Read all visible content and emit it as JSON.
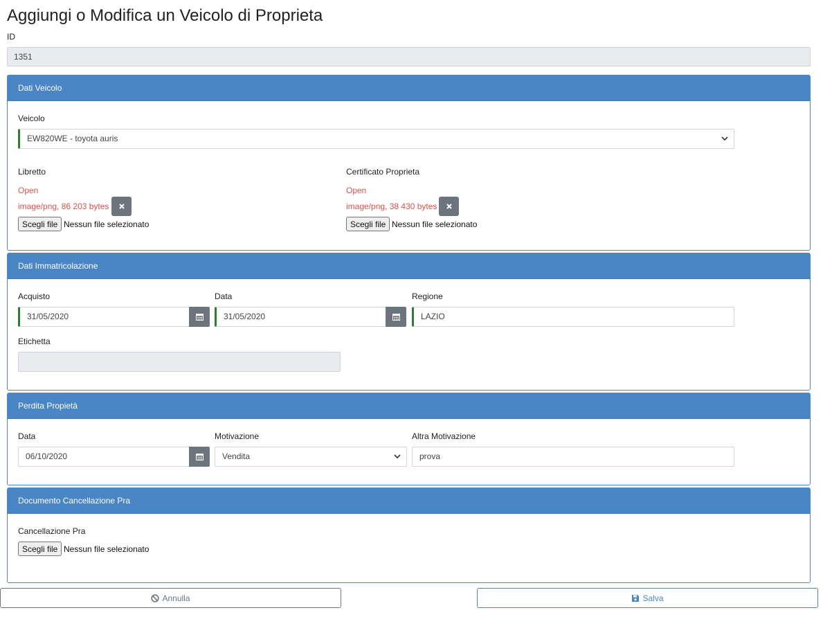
{
  "page": {
    "title": "Aggiungi o Modifica un Veicolo di Proprieta"
  },
  "id_field": {
    "label": "ID",
    "value": "1351"
  },
  "dati_veicolo": {
    "heading": "Dati Veicolo",
    "veicolo_label": "Veicolo",
    "veicolo_value": "EW820WE - toyota auris",
    "libretto": {
      "label": "Libretto",
      "link": "Open",
      "file_info": "image/png, 86 203 bytes",
      "choose_label": "Scegli file",
      "no_file": "Nessun file selezionato"
    },
    "certificato": {
      "label": "Certificato Proprieta",
      "link": "Open",
      "file_info": "image/png, 38 430 bytes",
      "choose_label": "Scegli file",
      "no_file": "Nessun file selezionato"
    }
  },
  "dati_immatricolazione": {
    "heading": "Dati Immatricolazione",
    "acquisto_label": "Acquisto",
    "acquisto_value": "31/05/2020",
    "data_label": "Data",
    "data_value": "31/05/2020",
    "regione_label": "Regione",
    "regione_value": "LAZIO",
    "etichetta_label": "Etichetta",
    "etichetta_value": ""
  },
  "perdita_proprieta": {
    "heading": "Perdita Propietà",
    "data_label": "Data",
    "data_value": "06/10/2020",
    "motivazione_label": "Motivazione",
    "motivazione_value": "Vendita",
    "altra_label": "Altra Motivazione",
    "altra_value": "prova"
  },
  "documento_cancellazione": {
    "heading": "Documento Cancellazione Pra",
    "label": "Cancellazione Pra",
    "choose_label": "Scegli file",
    "no_file": "Nessun file selezionato"
  },
  "footer": {
    "cancel_label": "Annulla",
    "save_label": "Salva"
  },
  "colors": {
    "primary": "#4a86c5",
    "danger": "#d9534f",
    "secondary": "#6c757d",
    "valid": "#2e7d32"
  },
  "icons": {
    "cancel": "ban-icon",
    "save": "floppy-icon",
    "calendar": "calendar-icon",
    "remove": "times-icon"
  }
}
